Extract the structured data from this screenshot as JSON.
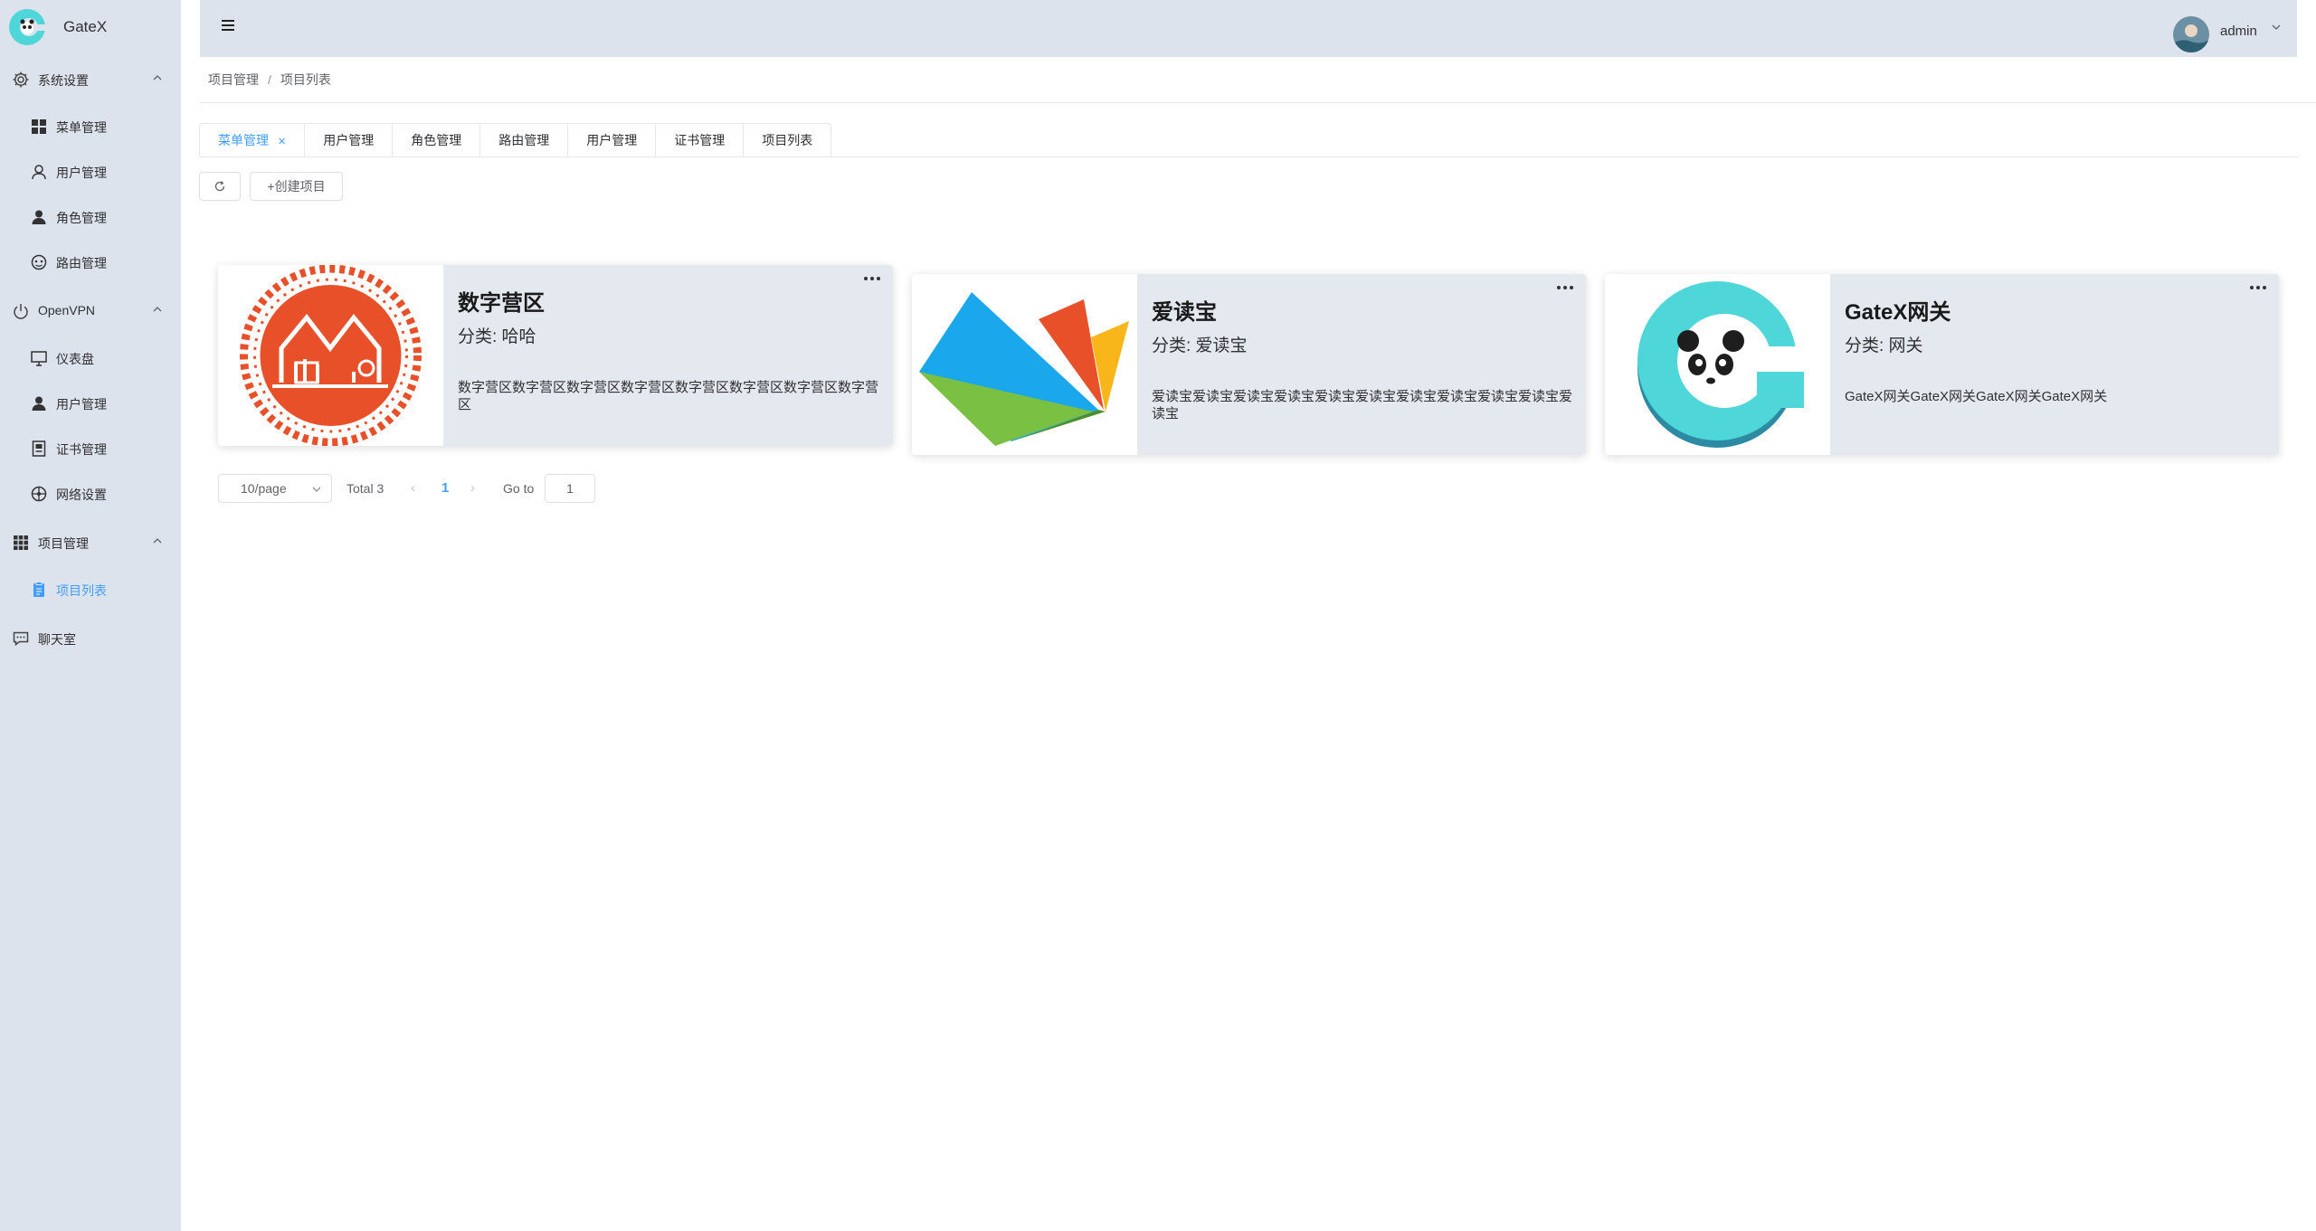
{
  "app": {
    "title": "GateX"
  },
  "sidebar": {
    "groups": [
      {
        "label": "系统设置",
        "icon": "gear-icon",
        "expanded": true,
        "items": [
          {
            "label": "菜单管理",
            "icon": "grid-icon"
          },
          {
            "label": "用户管理",
            "icon": "user-outline-icon"
          },
          {
            "label": "角色管理",
            "icon": "user-solid-icon"
          },
          {
            "label": "路由管理",
            "icon": "route-icon"
          }
        ]
      },
      {
        "label": "OpenVPN",
        "icon": "power-icon",
        "expanded": true,
        "items": [
          {
            "label": "仪表盘",
            "icon": "monitor-icon"
          },
          {
            "label": "用户管理",
            "icon": "user-solid-icon"
          },
          {
            "label": "证书管理",
            "icon": "certificate-icon"
          },
          {
            "label": "网络设置",
            "icon": "network-icon"
          }
        ]
      },
      {
        "label": "项目管理",
        "icon": "apps-icon",
        "expanded": true,
        "items": [
          {
            "label": "项目列表",
            "icon": "clipboard-icon",
            "active": true
          }
        ]
      },
      {
        "label": "聊天室",
        "icon": "chat-icon"
      }
    ]
  },
  "header": {
    "username": "admin"
  },
  "breadcrumb": {
    "items": [
      "项目管理",
      "项目列表"
    ],
    "separator": "/"
  },
  "tabs": [
    "菜单管理",
    "用户管理",
    "角色管理",
    "路由管理",
    "用户管理",
    "证书管理",
    "项目列表"
  ],
  "toolbar": {
    "create_label": "+创建项目"
  },
  "projects": [
    {
      "title": "数字营区",
      "category": "分类: 哈哈",
      "description": "数字营区数字营区数字营区数字营区数字营区数字营区数字营区数字营区",
      "logo": "camp-emblem-logo"
    },
    {
      "title": "爱读宝",
      "category": "分类: 爱读宝",
      "description": "爱读宝爱读宝爱读宝爱读宝爱读宝爱读宝爱读宝爱读宝爱读宝爱读宝爱读宝",
      "logo": "book-logo"
    },
    {
      "title": "GateX网关",
      "category": "分类: 网关",
      "description": "GateX网关GateX网关GateX网关GateX网关",
      "logo": "gatex-panda-logo"
    }
  ],
  "pagination": {
    "page_size": "10/page",
    "total": "Total 3",
    "current_page": "1",
    "goto_label": "Go to",
    "goto_value": "1"
  },
  "colors": {
    "sidebar_bg": "#dce3ec",
    "accent": "#409eff",
    "card_bg": "#e4e9f0",
    "camp_logo": "#e8502a",
    "gatex_logo": "#4fd6d8"
  }
}
